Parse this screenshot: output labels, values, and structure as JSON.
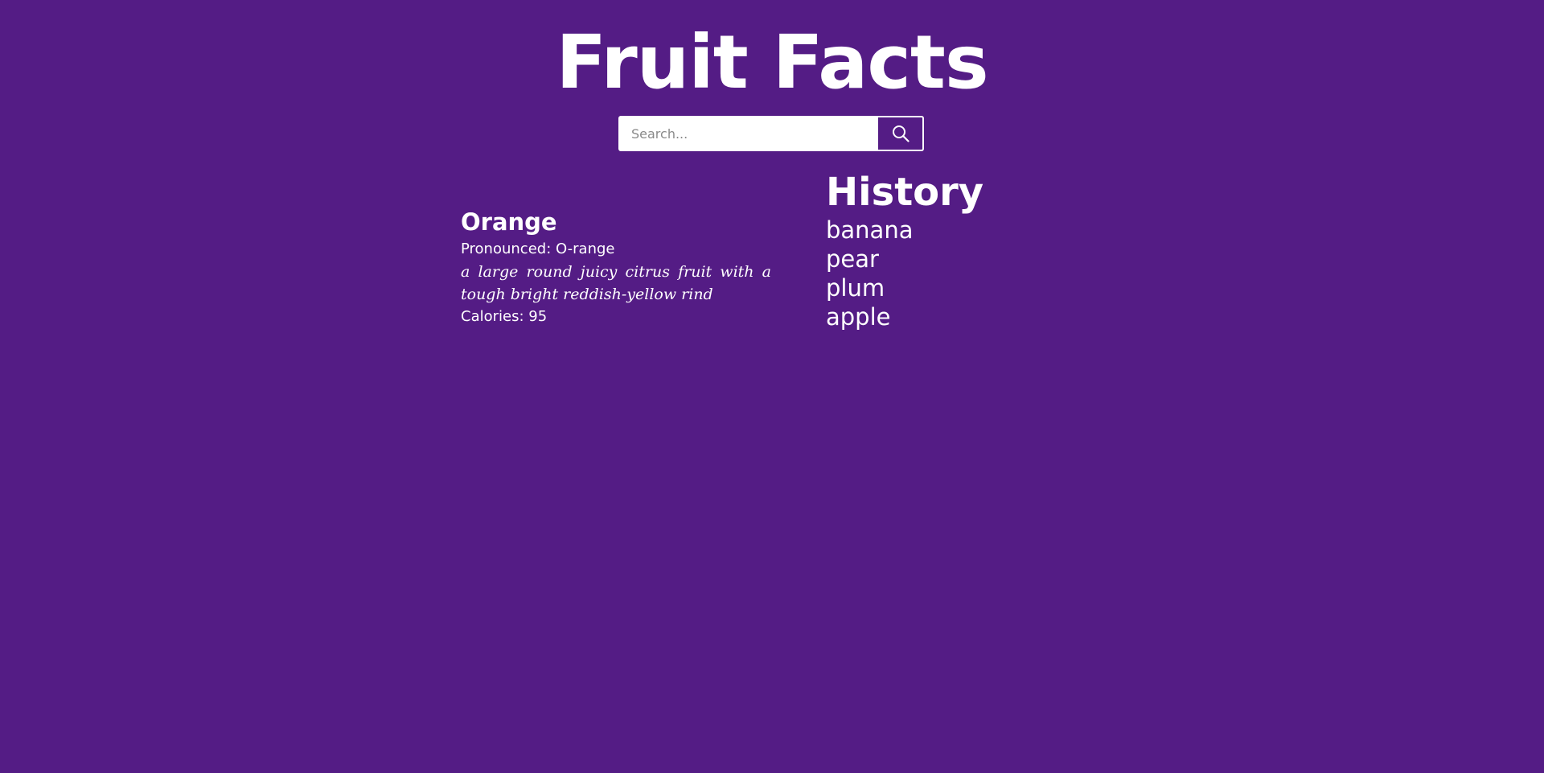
{
  "header": {
    "title": "Fruit Facts"
  },
  "search": {
    "placeholder": "Search...",
    "value": "",
    "button_icon": "search-icon"
  },
  "result": {
    "name": "Orange",
    "pronounced": "Pronounced: O-range",
    "definition": "a large round juicy citrus fruit with a tough bright reddish-yellow rind",
    "calories": "Calories: 95"
  },
  "history": {
    "title": "History",
    "items": [
      {
        "label": "banana"
      },
      {
        "label": "pear"
      },
      {
        "label": "plum"
      },
      {
        "label": "apple"
      }
    ]
  },
  "colors": {
    "background": "#541c85",
    "text": "#ffffff"
  }
}
